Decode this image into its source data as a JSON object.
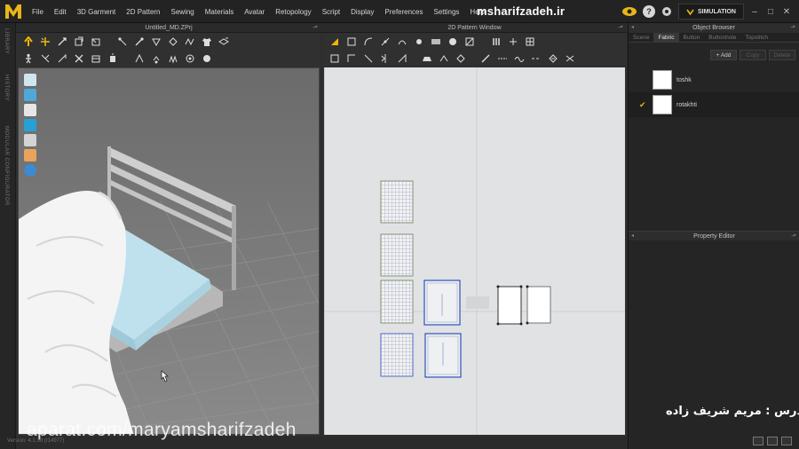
{
  "app": {
    "menu": [
      "File",
      "Edit",
      "3D Garment",
      "2D Pattern",
      "Sewing",
      "Materials",
      "Avatar",
      "Retopology",
      "Script",
      "Display",
      "Preferences",
      "Settings",
      "Help"
    ],
    "watermark_top": "msharifzadeh.ir",
    "simulation_label": "SIMULATION"
  },
  "left_strip": {
    "labels": [
      "LIBRARY",
      "HISTORY",
      "MODULAR CONFIGURATOR"
    ]
  },
  "viewport_3d": {
    "title": "Untitled_MD.ZPrj"
  },
  "viewport_2d": {
    "title": "2D Pattern Window"
  },
  "object_browser": {
    "title": "Object Browser",
    "tabs": [
      "Scene",
      "Fabric",
      "Button",
      "Buttonhole",
      "Topstitch"
    ],
    "active_tab": "Fabric",
    "buttons": {
      "add": "+ Add",
      "copy": "Copy",
      "delete": "Delete"
    },
    "fabrics": [
      {
        "name": "toshk",
        "selected": false
      },
      {
        "name": "rotakhti",
        "selected": true
      }
    ]
  },
  "property_editor": {
    "title": "Property Editor"
  },
  "overlay": {
    "instructor": "مدرس : مریم شریف زاده",
    "watermark_bottom": "aparat.com/maryamsharifzadeh",
    "version": "Version: 4.1.39 (r14977)"
  },
  "colors": {
    "accent": "#e0b31a",
    "background": "#2b2b2b",
    "pattern_bg": "#e0e2e4"
  }
}
